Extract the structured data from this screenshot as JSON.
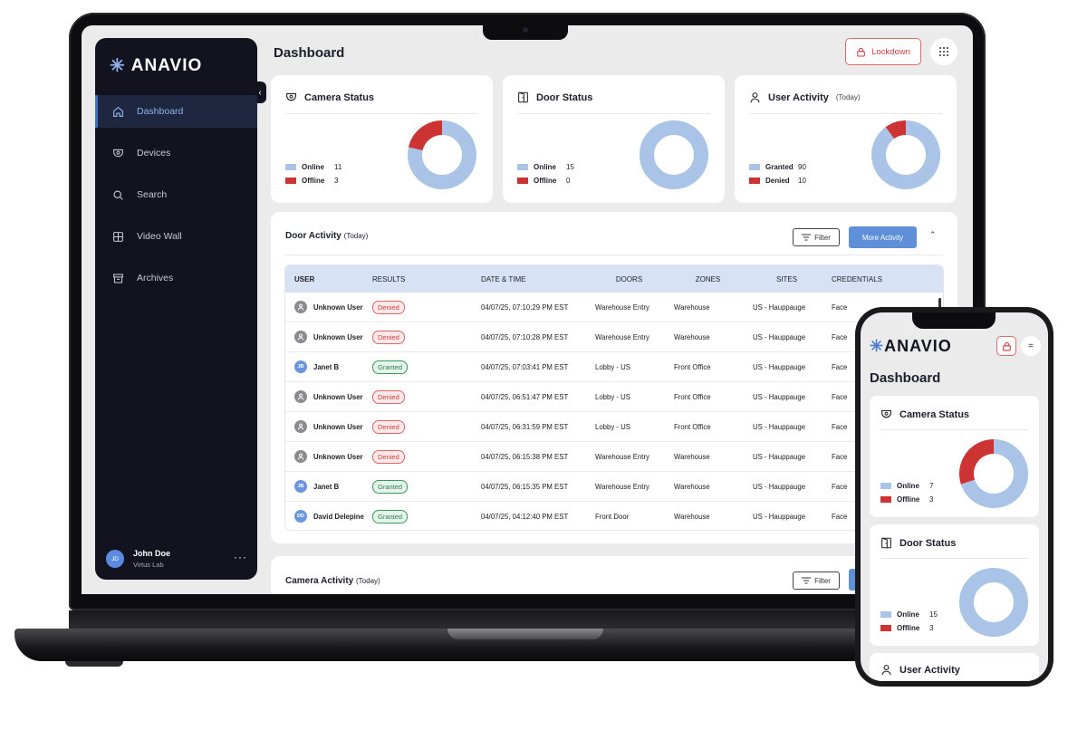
{
  "colors": {
    "accent": "#5e8fd8",
    "online": "#a9c4e6",
    "offline": "#cc3333",
    "sidebar": "#13131f",
    "lockdown": "#d23c3c"
  },
  "brand": {
    "name": "ANAVIO"
  },
  "header": {
    "title": "Dashboard",
    "lockdown_label": "Lockdown"
  },
  "sidebar": {
    "items": [
      {
        "label": "Dashboard",
        "icon": "home-icon"
      },
      {
        "label": "Devices",
        "icon": "camera-icon"
      },
      {
        "label": "Search",
        "icon": "search-icon"
      },
      {
        "label": "Video Wall",
        "icon": "grid-icon"
      },
      {
        "label": "Archives",
        "icon": "archive-icon"
      }
    ],
    "user": {
      "initials": "JD",
      "name": "John Doe",
      "org": "Virtus Lab"
    }
  },
  "status_cards": [
    {
      "title": "Camera Status",
      "subtitle": "",
      "legend": [
        {
          "label": "Online",
          "value": "11"
        },
        {
          "label": "Offline",
          "value": "3"
        }
      ]
    },
    {
      "title": "Door Status",
      "subtitle": "",
      "legend": [
        {
          "label": "Online",
          "value": "15"
        },
        {
          "label": "Offline",
          "value": "0"
        }
      ]
    },
    {
      "title": "User Activity",
      "subtitle": "(Today)",
      "legend": [
        {
          "label": "Granted",
          "value": "90"
        },
        {
          "label": "Denied",
          "value": "10"
        }
      ]
    }
  ],
  "door_activity": {
    "title": "Door Activity",
    "subtitle": "(Today)",
    "filter_label": "Filter",
    "more_label": "More Activity",
    "columns": [
      "USER",
      "RESULTS",
      "DATE & TIME",
      "DOORS",
      "ZONES",
      "SITES",
      "CREDENTIALS"
    ],
    "rows": [
      {
        "initials": "",
        "user": "Unknown User",
        "result": "Denied",
        "date": "04/07/25, 07:10:29 PM EST",
        "door": "Warehouse Entry",
        "zone": "Warehouse",
        "site": "US - Hauppauge",
        "cred": "Face"
      },
      {
        "initials": "",
        "user": "Unknown User",
        "result": "Denied",
        "date": "04/07/25, 07:10:28 PM EST",
        "door": "Warehouse Entry",
        "zone": "Warehouse",
        "site": "US - Hauppauge",
        "cred": "Face"
      },
      {
        "initials": "JB",
        "user": "Janet B",
        "result": "Granted",
        "date": "04/07/25, 07:03:41 PM EST",
        "door": "Lobby - US",
        "zone": "Front Office",
        "site": "US - Hauppauge",
        "cred": "Face"
      },
      {
        "initials": "",
        "user": "Unknown User",
        "result": "Denied",
        "date": "04/07/25, 06:51:47 PM EST",
        "door": "Lobby - US",
        "zone": "Front Office",
        "site": "US - Hauppauge",
        "cred": "Face"
      },
      {
        "initials": "",
        "user": "Unknown User",
        "result": "Denied",
        "date": "04/07/25, 06:31:59 PM EST",
        "door": "Lobby - US",
        "zone": "Front Office",
        "site": "US - Hauppauge",
        "cred": "Face"
      },
      {
        "initials": "",
        "user": "Unknown User",
        "result": "Denied",
        "date": "04/07/25, 06:15:38 PM EST",
        "door": "Warehouse Entry",
        "zone": "Warehouse",
        "site": "US - Hauppauge",
        "cred": "Face"
      },
      {
        "initials": "JB",
        "user": "Janet B",
        "result": "Granted",
        "date": "04/07/25, 06:15:35 PM EST",
        "door": "Warehouse Entry",
        "zone": "Warehouse",
        "site": "US - Hauppauge",
        "cred": "Face"
      },
      {
        "initials": "DD",
        "user": "David Delepine",
        "result": "Granted",
        "date": "04/07/25, 04:12:40 PM EST",
        "door": "Front Door",
        "zone": "Warehouse",
        "site": "US - Hauppauge",
        "cred": "Face"
      }
    ]
  },
  "camera_activity": {
    "title": "Camera Activity",
    "subtitle": "(Today)",
    "filter_label": "Filter"
  },
  "mobile": {
    "title": "Dashboard",
    "cards": [
      {
        "title": "Camera Status",
        "legend": [
          {
            "label": "Online",
            "value": "7"
          },
          {
            "label": "Offline",
            "value": "3"
          }
        ]
      },
      {
        "title": "Door Status",
        "legend": [
          {
            "label": "Online",
            "value": "15"
          },
          {
            "label": "Offline",
            "value": "3"
          }
        ]
      },
      {
        "title": "User Activity"
      }
    ]
  },
  "chart_data": [
    {
      "type": "pie",
      "title": "Camera Status",
      "categories": [
        "Online",
        "Offline"
      ],
      "values": [
        11,
        3
      ]
    },
    {
      "type": "pie",
      "title": "Door Status",
      "categories": [
        "Online",
        "Offline"
      ],
      "values": [
        15,
        0
      ]
    },
    {
      "type": "pie",
      "title": "User Activity",
      "categories": [
        "Granted",
        "Denied"
      ],
      "values": [
        90,
        10
      ]
    },
    {
      "type": "pie",
      "title": "Camera Status",
      "categories": [
        "Online",
        "Offline"
      ],
      "values": [
        7,
        3
      ]
    },
    {
      "type": "pie",
      "title": "Door Status",
      "categories": [
        "Online",
        "Offline"
      ],
      "values": [
        15,
        0
      ]
    }
  ]
}
